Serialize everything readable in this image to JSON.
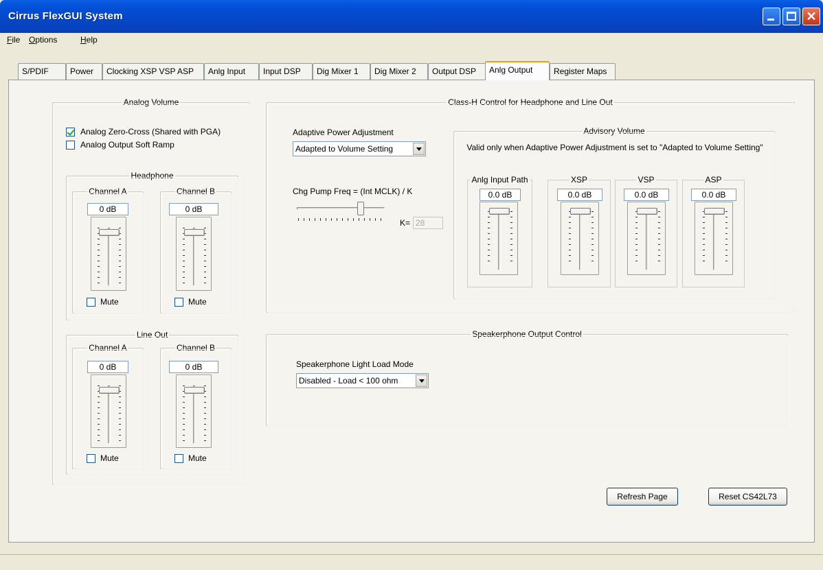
{
  "window": {
    "title": "Cirrus FlexGUI System"
  },
  "menu": {
    "file": {
      "accel": "F",
      "rest": "ile"
    },
    "options": {
      "accel": "O",
      "rest": "ptions"
    },
    "help": {
      "accel": "H",
      "rest": "elp"
    }
  },
  "tabs": [
    "S/PDIF",
    "Power",
    "Clocking XSP VSP ASP",
    "Anlg Input",
    "Input DSP",
    "Dig Mixer 1",
    "Dig Mixer 2",
    "Output DSP",
    "Anlg Output",
    "Register Maps"
  ],
  "active_tab": "Anlg Output",
  "analog_volume": {
    "title": "Analog Volume",
    "zero_cross": {
      "label": "Analog Zero-Cross (Shared with PGA)",
      "checked": true
    },
    "soft_ramp": {
      "label": "Analog Output Soft Ramp",
      "checked": false
    },
    "headphone": {
      "title": "Headphone",
      "channel_a": {
        "title": "Channel A",
        "value": "0 dB",
        "mute_label": "Mute",
        "muted": false
      },
      "channel_b": {
        "title": "Channel B",
        "value": "0 dB",
        "mute_label": "Mute",
        "muted": false
      }
    },
    "line_out": {
      "title": "Line Out",
      "channel_a": {
        "title": "Channel A",
        "value": "0 dB",
        "mute_label": "Mute",
        "muted": false
      },
      "channel_b": {
        "title": "Channel B",
        "value": "0 dB",
        "mute_label": "Mute",
        "muted": false
      }
    }
  },
  "class_h": {
    "title": "Class-H Control for Headphone and Line Out",
    "adaptive_label": "Adaptive Power Adjustment",
    "adaptive_value": "Adapted to Volume Setting",
    "chg_pump_label": "Chg Pump Freq = (Int MCLK) / K",
    "k_label": "K=",
    "k_value": "28",
    "advisory": {
      "title": "Advisory Volume",
      "note": "Valid only when Adaptive Power Adjustment is set to \"Adapted to Volume Setting\"",
      "anlg_input": {
        "title": "Anlg Input Path",
        "value": "0.0 dB"
      },
      "xsp": {
        "title": "XSP",
        "value": "0.0 dB"
      },
      "vsp": {
        "title": "VSP",
        "value": "0.0 dB"
      },
      "asp": {
        "title": "ASP",
        "value": "0.0 dB"
      }
    }
  },
  "speakerphone": {
    "title": "Speakerphone Output Control",
    "light_load_label": "Speakerphone Light Load Mode",
    "light_load_value": "Disabled - Load < 100 ohm"
  },
  "buttons": {
    "refresh": "Refresh Page",
    "reset": "Reset CS42L73"
  }
}
